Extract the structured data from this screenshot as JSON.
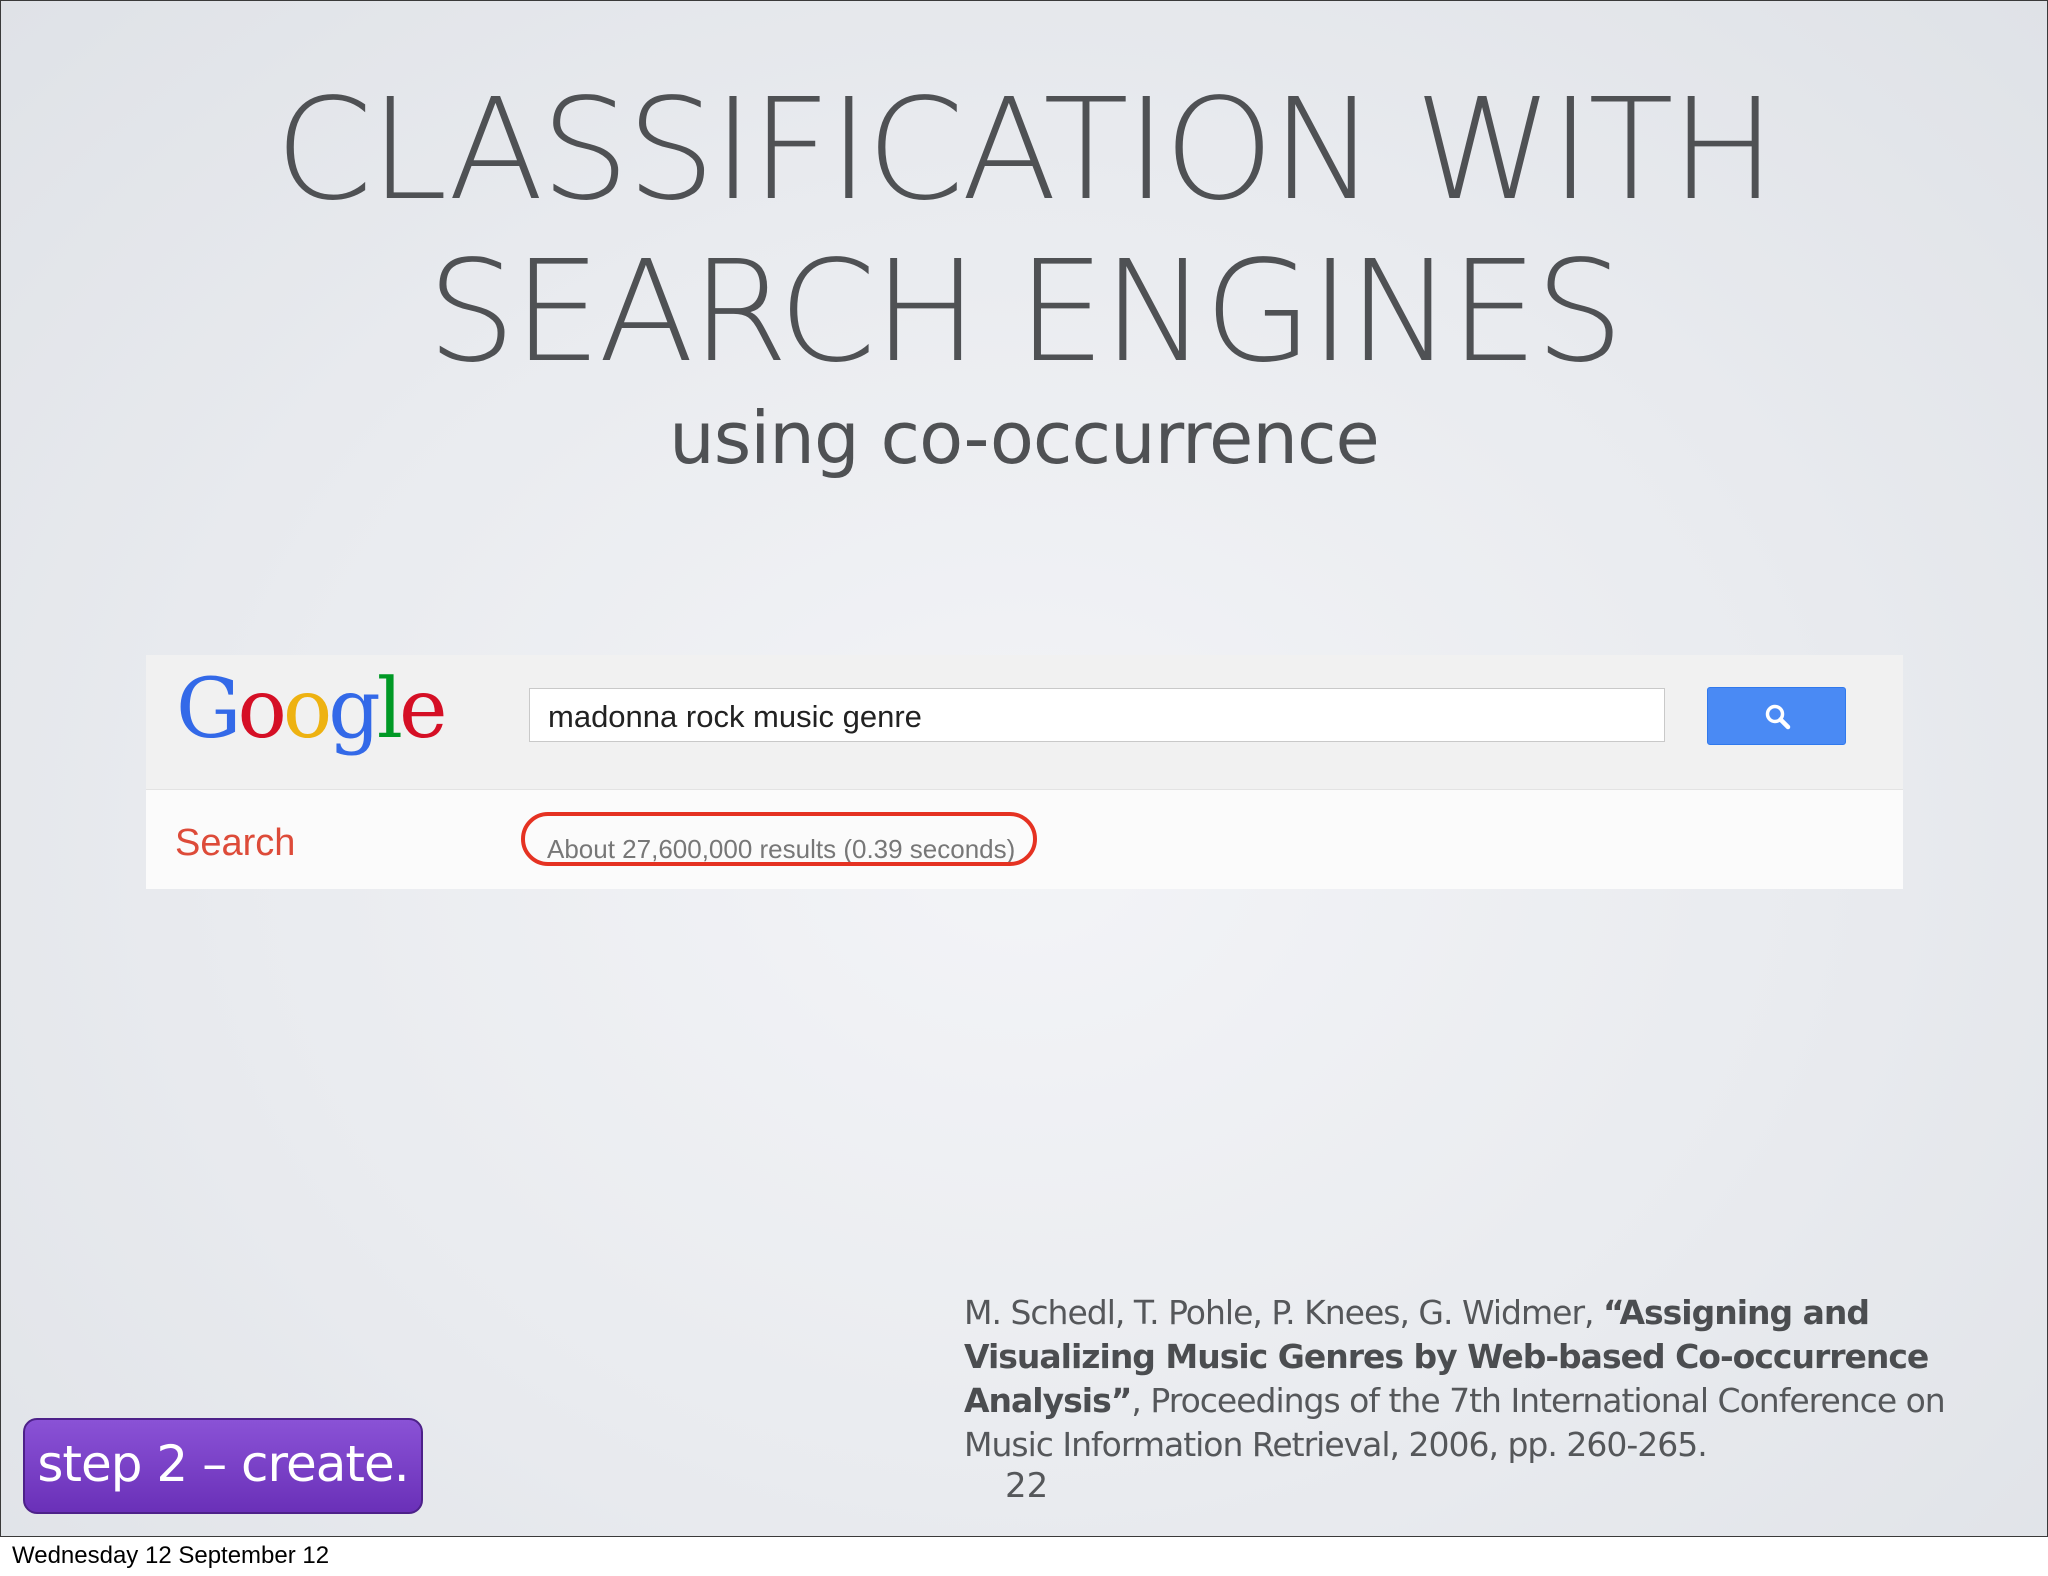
{
  "slide": {
    "title_line1": "CLASSIFICATION WITH",
    "title_line2": "SEARCH ENGINES",
    "subtitle": "using co-occurrence",
    "page_number": "22",
    "step_label": "step 2 – create."
  },
  "google": {
    "logo_letters": [
      {
        "char": "G",
        "color": "#3369e8"
      },
      {
        "char": "o",
        "color": "#d50f25"
      },
      {
        "char": "o",
        "color": "#eeb211"
      },
      {
        "char": "g",
        "color": "#3369e8"
      },
      {
        "char": "l",
        "color": "#009925"
      },
      {
        "char": "e",
        "color": "#d50f25"
      }
    ],
    "query": "madonna rock music genre",
    "search_button_icon": "search-icon",
    "search_label": "Search",
    "result_stats": "About 27,600,000 results (0.39 seconds)",
    "accent_color": "#4a8af4",
    "highlight_color": "#e53222"
  },
  "citation": {
    "authors": "M. Schedl, T. Pohle, P. Knees, G. Widmer,",
    "title": "“Assigning and Visualizing Music Genres by Web-based Co-occurrence Analysis”",
    "venue": ", Proceedings of the 7th International Conference on Music Information Retrieval, 2006, pp. 260-265."
  },
  "footer": {
    "date": "Wednesday 12 September 12"
  }
}
